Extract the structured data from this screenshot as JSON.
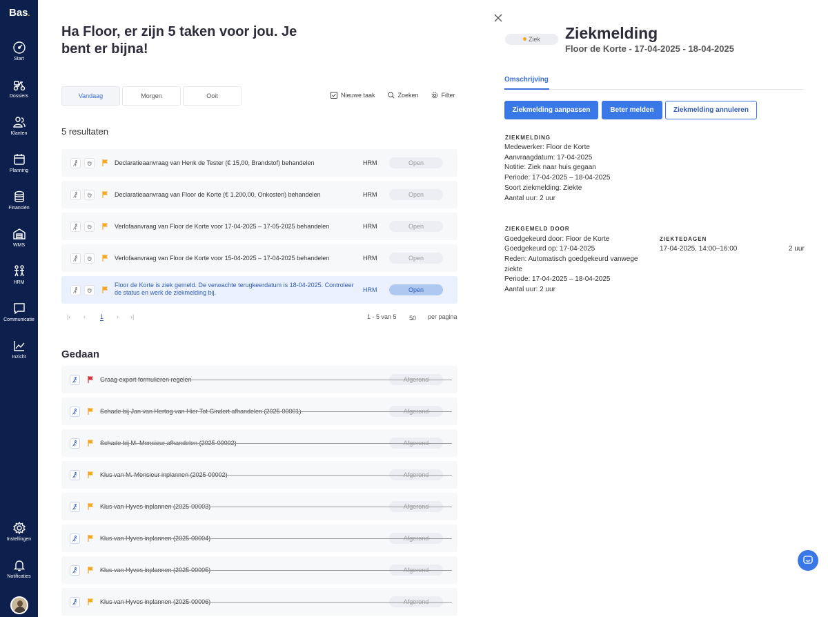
{
  "app": {
    "logo": "Bas",
    "logo_dot": "."
  },
  "sidebar": {
    "items": [
      {
        "label": "Start",
        "icon": "gauge-icon"
      },
      {
        "label": "Dossiers",
        "icon": "scooter-icon"
      },
      {
        "label": "Klanten",
        "icon": "users-icon"
      },
      {
        "label": "Planning",
        "icon": "calendar-icon"
      },
      {
        "label": "Financiën",
        "icon": "coins-icon"
      },
      {
        "label": "WMS",
        "icon": "warehouse-icon"
      },
      {
        "label": "HRM",
        "icon": "people-icon"
      },
      {
        "label": "Communicatie",
        "icon": "chat-icon"
      },
      {
        "label": "Inzicht",
        "icon": "chart-icon"
      }
    ],
    "bottom_items": [
      {
        "label": "Instellingen",
        "icon": "gear-icon"
      },
      {
        "label": "Notificaties",
        "icon": "bell-icon"
      }
    ]
  },
  "main": {
    "greeting": "Ha Floor, er zijn 5 taken voor jou. Je bent er bijna!",
    "tabs": [
      "Vandaag",
      "Morgen",
      "Ooit"
    ],
    "toolbar": {
      "new_task": "Nieuwe taak",
      "search": "Zoeken",
      "filter": "Filter"
    },
    "results": "5 resultaten",
    "tasks": [
      {
        "text": "Declaratieaanvraag van Henk de Tester (€ 15,00, Brandstof) behandelen",
        "category": "HRM",
        "status": "Open"
      },
      {
        "text": "Declaratieaanvraag van Floor de Korte (€ 1.200,00, Onkosten) behandelen",
        "category": "HRM",
        "status": "Open"
      },
      {
        "text": "Verlofaanvraag van Floor de Korte voor 17-04-2025 – 17-05-2025 behandelen",
        "category": "HRM",
        "status": "Open"
      },
      {
        "text": "Verlofaanvraag van Floor de Korte voor 15-04-2025 – 17-04-2025 behandelen",
        "category": "HRM",
        "status": "Open"
      },
      {
        "text": "Floor de Korte is ziek gemeld. De verwachte terugkeerdatum is 18-04-2025. Controleer de status en werk de ziekmelding bij.",
        "category": "HRM",
        "status": "Open"
      }
    ],
    "pager": {
      "page": "1",
      "range": "1 - 5 van 5",
      "per_page": "50",
      "per_page_label": "per pagina"
    },
    "done_title": "Gedaan",
    "done_tasks": [
      {
        "text": "Graag export formulieren regelen",
        "status": "Afgerond"
      },
      {
        "text": "Schade bij Jan van Hertog van Hier Tot Gindert afhandelen (2025-00001)",
        "status": "Afgerond"
      },
      {
        "text": "Schade bij M. Monsieur afhandelen (2025-00002)",
        "status": "Afgerond"
      },
      {
        "text": "Klus van M. Monsieur inplannen (2025-00002)",
        "status": "Afgerond"
      },
      {
        "text": "Klus van Hyves inplannen (2025-00003)",
        "status": "Afgerond"
      },
      {
        "text": "Klus van Hyves inplannen (2025-00004)",
        "status": "Afgerond"
      },
      {
        "text": "Klus van Hyves inplannen (2025-00005)",
        "status": "Afgerond"
      },
      {
        "text": "Klus van Hyves inplannen (2025-00006)",
        "status": "Afgerond"
      }
    ]
  },
  "detail": {
    "badge": "Ziek",
    "title": "Ziekmelding",
    "subtitle": "Floor de Korte - 17-04-2025 - 18-04-2025",
    "tab": "Omschrijving",
    "buttons": {
      "edit": "Ziekmelding aanpassen",
      "better": "Beter melden",
      "cancel": "Ziekmelding annuleren"
    },
    "ziekmelding_header": "ZIEKMELDING",
    "ziekmelding_lines": [
      "Medewerker: Floor de Korte",
      "Aanvraagdatum: 17-04-2025",
      "Notitie: Ziek naar huis gegaan",
      "Periode: 17-04-2025 – 18-04-2025",
      "Soort ziekmelding: Ziekte",
      "Aantal uur: 2 uur"
    ],
    "ziekgemeld_header": "ZIEKGEMELD DOOR",
    "ziekgemeld_lines": [
      "Goedgekeurd door: Floor de Korte",
      "Goedgekeurd op: 17-04-2025",
      "Reden: Automatisch goedgekeurd vanwege",
      "ziekte",
      "Periode: 17-04-2025 – 18-04-2025",
      "Aantal uur: 2 uur"
    ],
    "ziektedagen_header": "ZIEKTEDAGEN",
    "ziektedagen_entry": "17-04-2025, 14:00–16:00",
    "ziektedagen_hours": "2 uur"
  },
  "colors": {
    "sidebar": "#0d1f4d",
    "accent": "#3a78e8",
    "flag_orange": "#f5a623",
    "flag_red": "#d0383f"
  }
}
